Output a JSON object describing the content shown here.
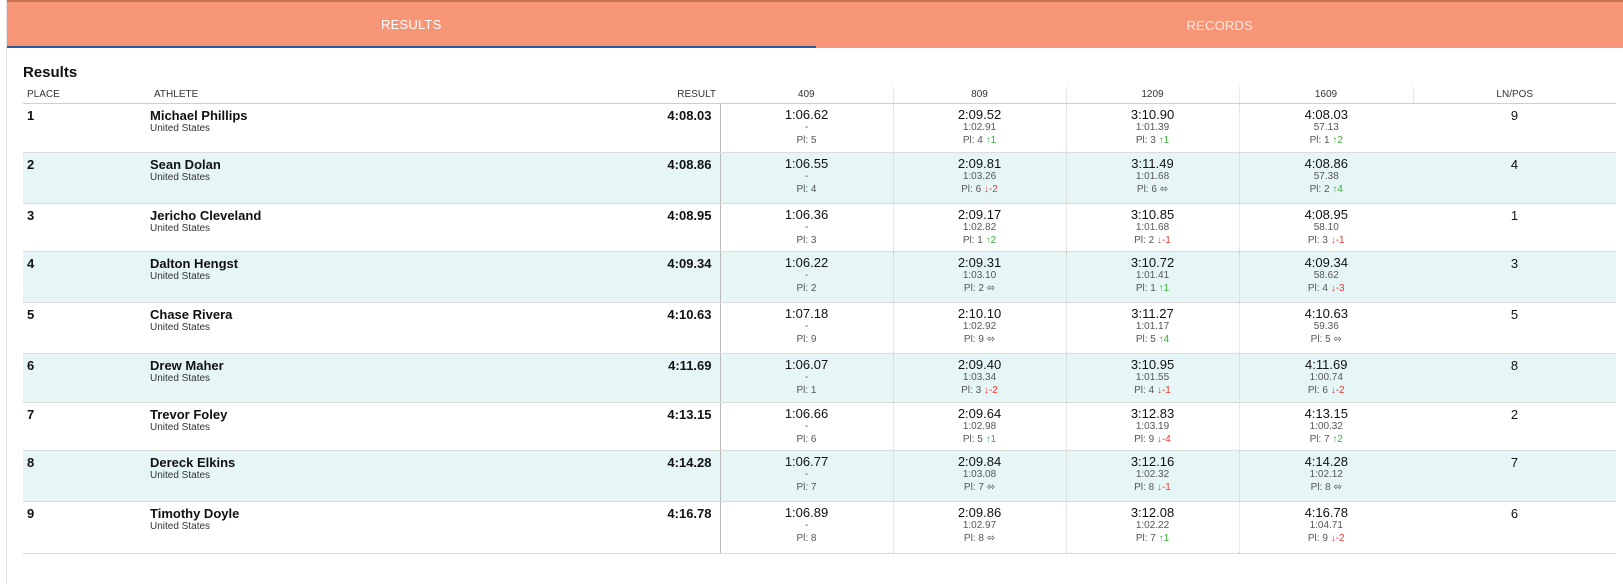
{
  "tabs": [
    {
      "label": "RESULTS",
      "active": true
    },
    {
      "label": "RECORDS",
      "active": false
    }
  ],
  "section_title": "Results",
  "columns": {
    "place": "PLACE",
    "athlete": "ATHLETE",
    "result": "RESULT",
    "splits": [
      "409",
      "809",
      "1209",
      "1609"
    ],
    "lnpos": "LN/POS"
  },
  "colors": {
    "tab_bar": "#f79677",
    "alt_row": "#e6f6f6",
    "up": "#3cae3c",
    "down": "#e53935"
  },
  "rows": [
    {
      "place": "1",
      "name": "Michael Phillips",
      "team": "United States",
      "result": "4:08.03",
      "lnpos": "9",
      "splits": [
        {
          "time": "1:06.62",
          "lap": "-",
          "pl": "Pl: 5",
          "mv": "",
          "dir": "none"
        },
        {
          "time": "2:09.52",
          "lap": "1:02.91",
          "pl": "Pl: 4",
          "mv": "↑1",
          "dir": "up"
        },
        {
          "time": "3:10.90",
          "lap": "1:01.39",
          "pl": "Pl: 3",
          "mv": "↑1",
          "dir": "up"
        },
        {
          "time": "4:08.03",
          "lap": "57.13",
          "pl": "Pl: 1",
          "mv": "↑2",
          "dir": "up"
        }
      ]
    },
    {
      "place": "2",
      "name": "Sean Dolan",
      "team": "United States",
      "result": "4:08.86",
      "lnpos": "4",
      "splits": [
        {
          "time": "1:06.55",
          "lap": "-",
          "pl": "Pl: 4",
          "mv": "",
          "dir": "none"
        },
        {
          "time": "2:09.81",
          "lap": "1:03.26",
          "pl": "Pl: 6",
          "mv": "↓-2",
          "dir": "down"
        },
        {
          "time": "3:11.49",
          "lap": "1:01.68",
          "pl": "Pl: 6",
          "mv": "⬄",
          "dir": "same"
        },
        {
          "time": "4:08.86",
          "lap": "57.38",
          "pl": "Pl: 2",
          "mv": "↑4",
          "dir": "up"
        }
      ]
    },
    {
      "place": "3",
      "name": "Jericho Cleveland",
      "team": "United States",
      "result": "4:08.95",
      "lnpos": "1",
      "splits": [
        {
          "time": "1:06.36",
          "lap": "-",
          "pl": "Pl: 3",
          "mv": "",
          "dir": "none"
        },
        {
          "time": "2:09.17",
          "lap": "1:02.82",
          "pl": "Pl: 1",
          "mv": "↑2",
          "dir": "up"
        },
        {
          "time": "3:10.85",
          "lap": "1:01.68",
          "pl": "Pl: 2",
          "mv": "↓-1",
          "dir": "down"
        },
        {
          "time": "4:08.95",
          "lap": "58.10",
          "pl": "Pl: 3",
          "mv": "↓-1",
          "dir": "down"
        }
      ]
    },
    {
      "place": "4",
      "name": "Dalton Hengst",
      "team": "United States",
      "result": "4:09.34",
      "lnpos": "3",
      "splits": [
        {
          "time": "1:06.22",
          "lap": "-",
          "pl": "Pl: 2",
          "mv": "",
          "dir": "none"
        },
        {
          "time": "2:09.31",
          "lap": "1:03.10",
          "pl": "Pl: 2",
          "mv": "⬄",
          "dir": "same"
        },
        {
          "time": "3:10.72",
          "lap": "1:01.41",
          "pl": "Pl: 1",
          "mv": "↑1",
          "dir": "up"
        },
        {
          "time": "4:09.34",
          "lap": "58.62",
          "pl": "Pl: 4",
          "mv": "↓-3",
          "dir": "down"
        }
      ]
    },
    {
      "place": "5",
      "name": "Chase Rivera",
      "team": "United States",
      "result": "4:10.63",
      "lnpos": "5",
      "splits": [
        {
          "time": "1:07.18",
          "lap": "-",
          "pl": "Pl: 9",
          "mv": "",
          "dir": "none"
        },
        {
          "time": "2:10.10",
          "lap": "1:02.92",
          "pl": "Pl: 9",
          "mv": "⬄",
          "dir": "same"
        },
        {
          "time": "3:11.27",
          "lap": "1:01.17",
          "pl": "Pl: 5",
          "mv": "↑4",
          "dir": "up"
        },
        {
          "time": "4:10.63",
          "lap": "59.36",
          "pl": "Pl: 5",
          "mv": "⬄",
          "dir": "same"
        }
      ]
    },
    {
      "place": "6",
      "name": "Drew Maher",
      "team": "United States",
      "result": "4:11.69",
      "lnpos": "8",
      "splits": [
        {
          "time": "1:06.07",
          "lap": "-",
          "pl": "Pl: 1",
          "mv": "",
          "dir": "none"
        },
        {
          "time": "2:09.40",
          "lap": "1:03.34",
          "pl": "Pl: 3",
          "mv": "↓-2",
          "dir": "down"
        },
        {
          "time": "3:10.95",
          "lap": "1:01.55",
          "pl": "Pl: 4",
          "mv": "↓-1",
          "dir": "down"
        },
        {
          "time": "4:11.69",
          "lap": "1:00.74",
          "pl": "Pl: 6",
          "mv": "↓-2",
          "dir": "down"
        }
      ]
    },
    {
      "place": "7",
      "name": "Trevor Foley",
      "team": "United States",
      "result": "4:13.15",
      "lnpos": "2",
      "splits": [
        {
          "time": "1:06.66",
          "lap": "-",
          "pl": "Pl: 6",
          "mv": "",
          "dir": "none"
        },
        {
          "time": "2:09.64",
          "lap": "1:02.98",
          "pl": "Pl: 5",
          "mv": "↑1",
          "dir": "up"
        },
        {
          "time": "3:12.83",
          "lap": "1:03.19",
          "pl": "Pl: 9",
          "mv": "↓-4",
          "dir": "down"
        },
        {
          "time": "4:13.15",
          "lap": "1:00.32",
          "pl": "Pl: 7",
          "mv": "↑2",
          "dir": "up"
        }
      ]
    },
    {
      "place": "8",
      "name": "Dereck Elkins",
      "team": "United States",
      "result": "4:14.28",
      "lnpos": "7",
      "splits": [
        {
          "time": "1:06.77",
          "lap": "-",
          "pl": "Pl: 7",
          "mv": "",
          "dir": "none"
        },
        {
          "time": "2:09.84",
          "lap": "1:03.08",
          "pl": "Pl: 7",
          "mv": "⬄",
          "dir": "same"
        },
        {
          "time": "3:12.16",
          "lap": "1:02.32",
          "pl": "Pl: 8",
          "mv": "↓-1",
          "dir": "down"
        },
        {
          "time": "4:14.28",
          "lap": "1:02.12",
          "pl": "Pl: 8",
          "mv": "⬄",
          "dir": "same"
        }
      ]
    },
    {
      "place": "9",
      "name": "Timothy Doyle",
      "team": "United States",
      "result": "4:16.78",
      "lnpos": "6",
      "splits": [
        {
          "time": "1:06.89",
          "lap": "-",
          "pl": "Pl: 8",
          "mv": "",
          "dir": "none"
        },
        {
          "time": "2:09.86",
          "lap": "1:02.97",
          "pl": "Pl: 8",
          "mv": "⬄",
          "dir": "same"
        },
        {
          "time": "3:12.08",
          "lap": "1:02.22",
          "pl": "Pl: 7",
          "mv": "↑1",
          "dir": "up"
        },
        {
          "time": "4:16.78",
          "lap": "1:04.71",
          "pl": "Pl: 9",
          "mv": "↓-2",
          "dir": "down"
        }
      ]
    }
  ]
}
